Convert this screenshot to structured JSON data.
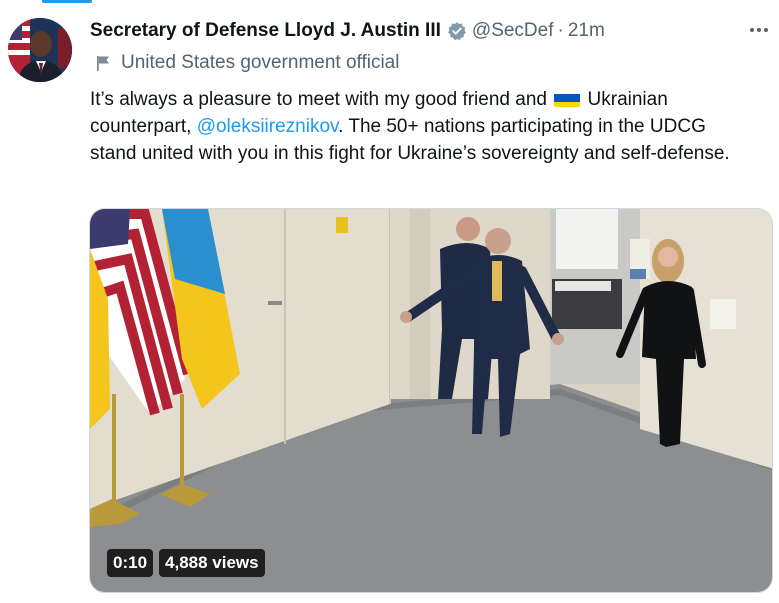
{
  "author": {
    "display_name": "Secretary of Defense Lloyd J. Austin III",
    "handle": "@SecDef",
    "separator": "·",
    "time": "21m",
    "label": "United States government official",
    "verified_color": "#829aab"
  },
  "tweet": {
    "text_part1": "It’s always a pleasure to meet with my good friend and",
    "text_part2": "Ukrainian counterpart,",
    "mention": "@oleksiireznikov",
    "text_part3": ". The 50+ nations participating in the UDCG stand united with you in this fight for Ukraine’s sovereignty and self-defense."
  },
  "video": {
    "duration": "0:10",
    "views": "4,888 views"
  },
  "icons": {
    "more": "more-options-icon",
    "verified": "verified-badge-icon",
    "government": "flag-icon",
    "ukraine_flag": "ukraine-flag-emoji"
  },
  "colors": {
    "link": "#1d9bf0",
    "secondary_text": "#536471",
    "primary_text": "#0f1419"
  }
}
